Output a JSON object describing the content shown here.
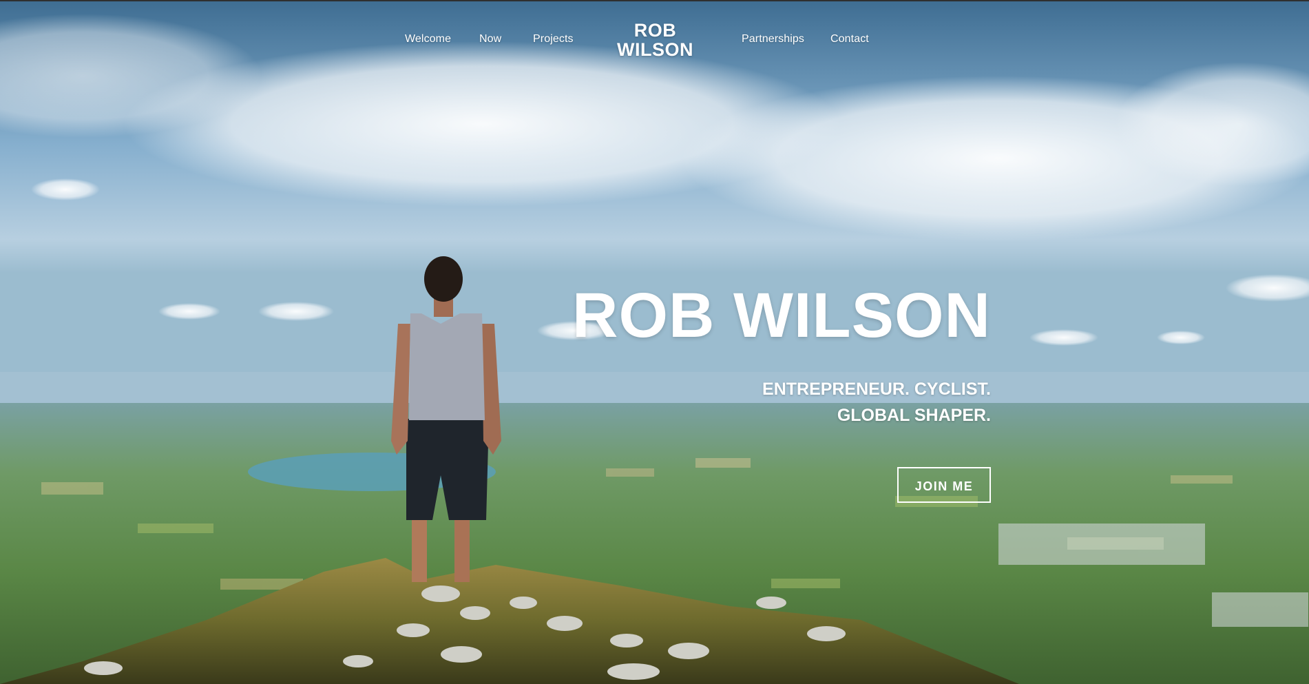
{
  "nav": {
    "items": [
      {
        "label": "Welcome"
      },
      {
        "label": "Now"
      },
      {
        "label": "Projects"
      },
      {
        "label": "Partnerships"
      },
      {
        "label": "Contact"
      }
    ],
    "logo": {
      "line1": "ROB",
      "line2": "WILSON"
    }
  },
  "hero": {
    "title": "ROB WILSON",
    "subtitle_line1": "ENTREPRENEUR. CYCLIST.",
    "subtitle_line2": "GLOBAL SHAPER.",
    "cta_label": "JOIN ME"
  },
  "colors": {
    "text": "#ffffff",
    "sky": "#8fb5d2",
    "landscape": "#5e8a4a"
  }
}
